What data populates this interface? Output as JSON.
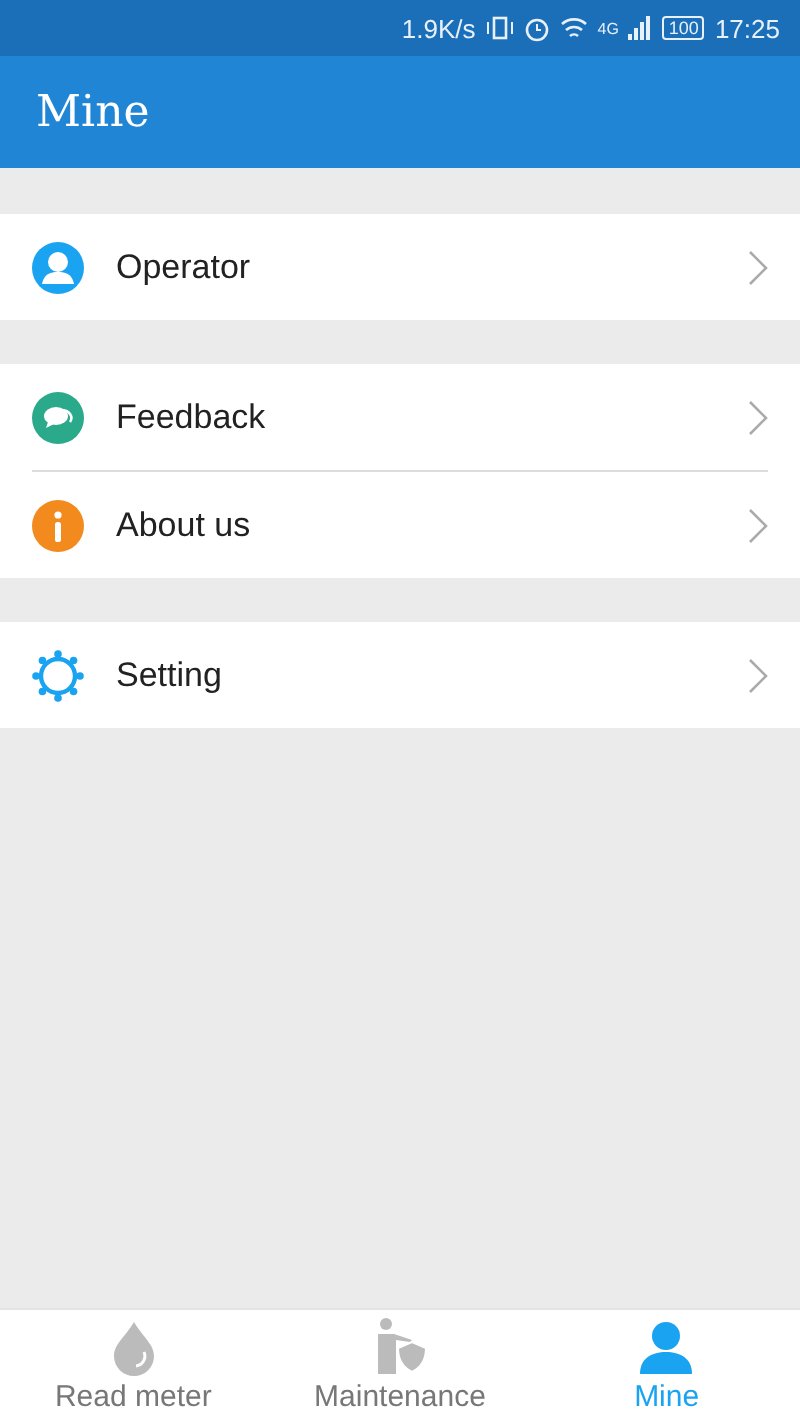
{
  "status_bar": {
    "speed": "1.9K/s",
    "network": "4G",
    "battery": "100",
    "time": "17:25"
  },
  "header": {
    "title": "Mine"
  },
  "groups": [
    {
      "items": [
        {
          "label": "Operator",
          "kind": "operator"
        }
      ]
    },
    {
      "items": [
        {
          "label": "Feedback",
          "kind": "feedback"
        },
        {
          "label": "About us",
          "kind": "about"
        }
      ]
    },
    {
      "items": [
        {
          "label": "Setting",
          "kind": "setting"
        }
      ]
    }
  ],
  "bottom_nav": [
    {
      "label": "Read meter",
      "kind": "drop",
      "selected": false
    },
    {
      "label": "Maintenance",
      "kind": "worker",
      "selected": false
    },
    {
      "label": "Mine",
      "kind": "person",
      "selected": true
    }
  ]
}
